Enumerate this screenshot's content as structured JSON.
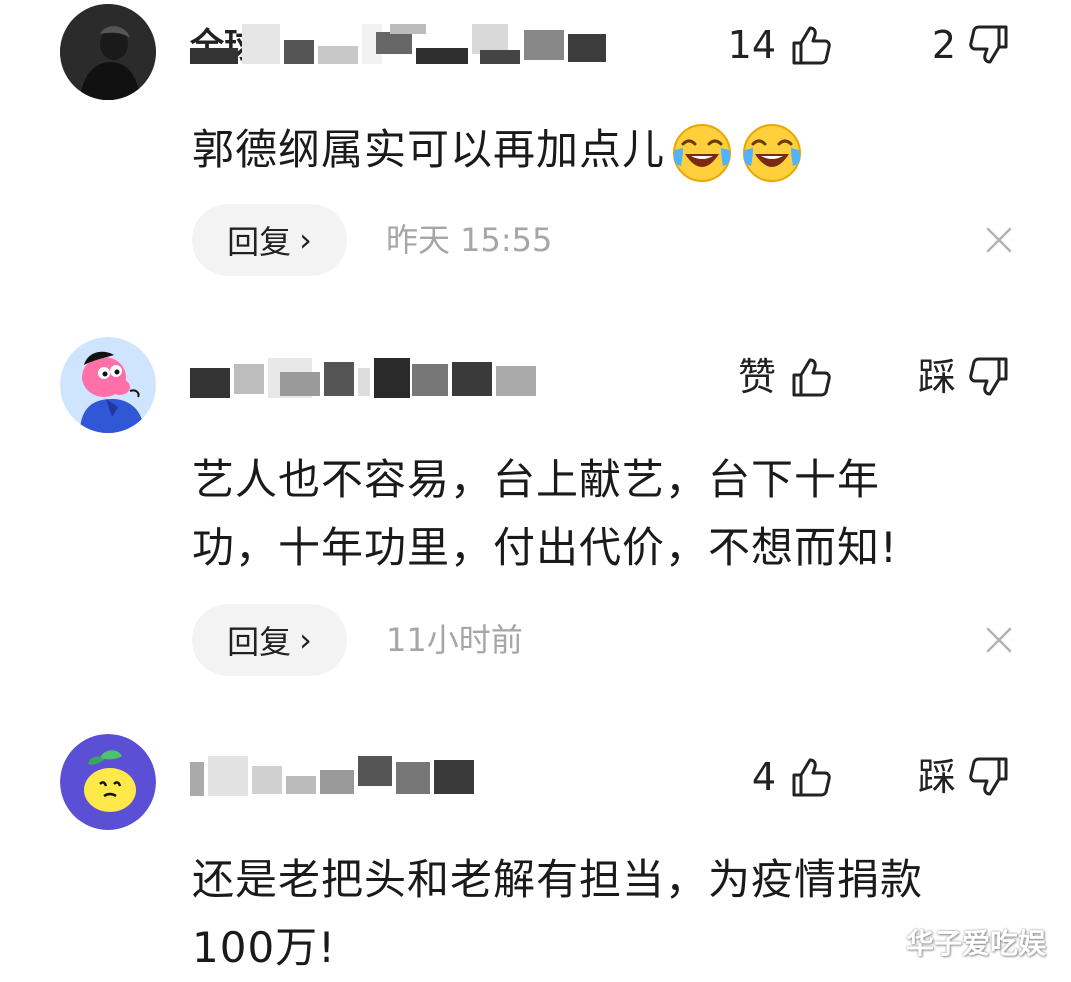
{
  "comments": [
    {
      "username": "全球",
      "votes": {
        "like_label": "14",
        "dislike_label": "2"
      },
      "content_lines": [
        "郭德纲属实可以再加点儿"
      ],
      "emoji": [
        "face-with-tears-of-joy",
        "face-with-tears-of-joy"
      ],
      "reply_label": "回复",
      "reply_chevron": "›",
      "timestamp": "昨天  15:55"
    },
    {
      "username": "",
      "votes": {
        "like_label": "赞",
        "dislike_label": "踩"
      },
      "content_lines": [
        "艺人也不容易，台上献艺，台下十年",
        "功，十年功里，付出代价，不想而知!"
      ],
      "reply_label": "回复",
      "reply_chevron": "›",
      "timestamp": "11小时前"
    },
    {
      "username": "",
      "votes": {
        "like_label": "4",
        "dislike_label": "踩"
      },
      "content_lines": [
        "还是老把头和老解有担当，为疫情捐款",
        "100万!"
      ]
    }
  ],
  "watermark": "华子爱吃娱",
  "colors": {
    "text": "#1a1a1a",
    "muted": "#a6a6a6",
    "pill": "#f3f3f3"
  }
}
